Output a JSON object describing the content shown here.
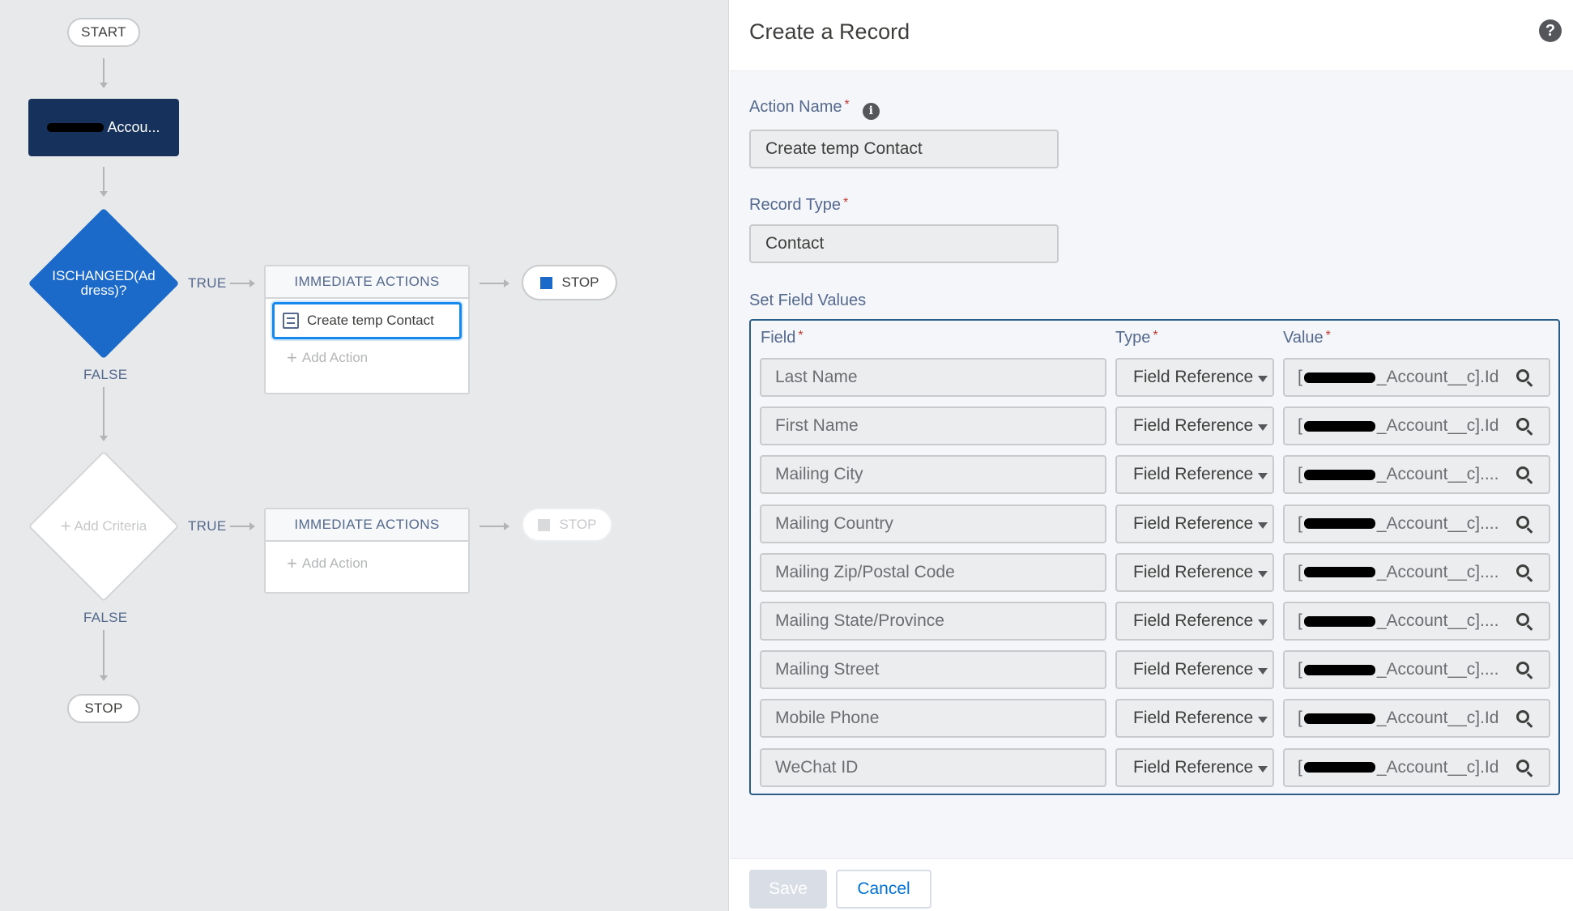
{
  "canvas": {
    "start_label": "START",
    "object_node_label": "Accou...",
    "criteria1_label": "ISCHANGED(Ad\ndress)?",
    "criteria1_true": "TRUE",
    "criteria1_false": "FALSE",
    "immediate_actions_1": "IMMEDIATE ACTIONS",
    "action1_label": "Create temp Contact",
    "add_action_1": "Add Action",
    "stop_1": "STOP",
    "criteria2_label": "Add Criteria",
    "criteria2_true": "TRUE",
    "criteria2_false": "FALSE",
    "immediate_actions_2": "IMMEDIATE ACTIONS",
    "add_action_2": "Add Action",
    "stop_2": "STOP",
    "stop_end": "STOP"
  },
  "panel": {
    "title": "Create a Record",
    "help_icon": "question-circle-icon",
    "action_name_label": "Action Name",
    "action_name_value": "Create temp Contact",
    "record_type_label": "Record Type",
    "record_type_value": "Contact",
    "set_field_values_label": "Set Field Values",
    "col_field": "Field",
    "col_type": "Type",
    "col_value": "Value",
    "required_mark": "*",
    "rows": [
      {
        "field": "Last Name",
        "type": "Field Reference",
        "value_prefix": "[",
        "value_suffix": "_Account__c].Id"
      },
      {
        "field": "First Name",
        "type": "Field Reference",
        "value_prefix": "[",
        "value_suffix": "_Account__c].Id"
      },
      {
        "field": "Mailing City",
        "type": "Field Reference",
        "value_prefix": "[",
        "value_suffix": "_Account__c]...."
      },
      {
        "field": "Mailing Country",
        "type": "Field Reference",
        "value_prefix": "[",
        "value_suffix": "_Account__c]...."
      },
      {
        "field": "Mailing Zip/Postal Code",
        "type": "Field Reference",
        "value_prefix": "[",
        "value_suffix": "_Account__c]...."
      },
      {
        "field": "Mailing State/Province",
        "type": "Field Reference",
        "value_prefix": "[",
        "value_suffix": "_Account__c]...."
      },
      {
        "field": "Mailing Street",
        "type": "Field Reference",
        "value_prefix": "[",
        "value_suffix": "_Account__c]...."
      },
      {
        "field": "Mobile Phone",
        "type": "Field Reference",
        "value_prefix": "[",
        "value_suffix": "_Account__c].Id"
      },
      {
        "field": "WeChat ID",
        "type": "Field Reference",
        "value_prefix": "[",
        "value_suffix": "_Account__c].Id"
      }
    ],
    "save_label": "Save",
    "cancel_label": "Cancel"
  },
  "colors": {
    "navy_node": "#16325c",
    "criteria_blue": "#1b6ac9",
    "focus_blue": "#1589ee",
    "link_blue": "#0070d2",
    "required_red": "#c23934"
  }
}
